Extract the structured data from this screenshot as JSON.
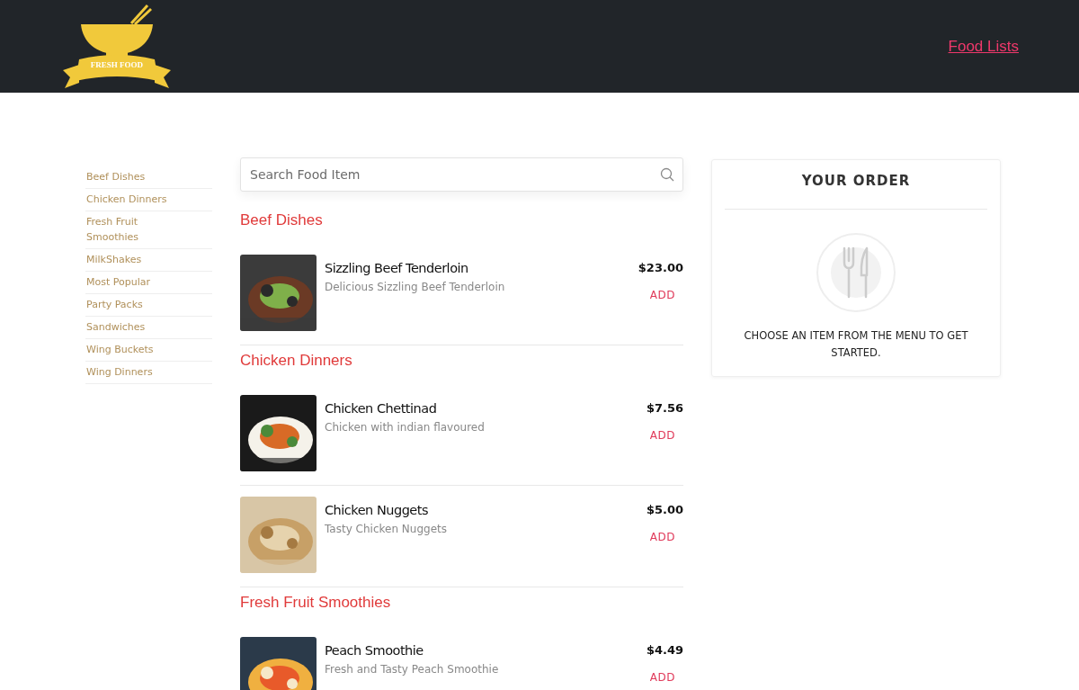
{
  "header": {
    "logo_text": "FRESH FOOD",
    "nav_link": "Food Lists"
  },
  "sidebar": {
    "items": [
      "Beef Dishes",
      "Chicken Dinners",
      "Fresh Fruit Smoothies",
      "MilkShakes",
      "Most Popular",
      "Party Packs",
      "Sandwiches",
      "Wing Buckets",
      "Wing Dinners"
    ]
  },
  "search": {
    "placeholder": "Search Food Item"
  },
  "sections": [
    {
      "title": "Beef Dishes",
      "items": [
        {
          "name": "Sizzling Beef Tenderloin",
          "description": "Delicious Sizzling Beef Tenderloin",
          "price": "$23.00",
          "action": "ADD"
        }
      ]
    },
    {
      "title": "Chicken Dinners",
      "items": [
        {
          "name": "Chicken Chettinad",
          "description": "Chicken with indian flavoured",
          "price": "$7.56",
          "action": "ADD"
        },
        {
          "name": "Chicken Nuggets",
          "description": "Tasty Chicken Nuggets",
          "price": "$5.00",
          "action": "ADD"
        }
      ]
    },
    {
      "title": "Fresh Fruit Smoothies",
      "items": [
        {
          "name": "Peach Smoothie",
          "description": "Fresh and Tasty Peach Smoothie",
          "price": "$4.49",
          "action": "ADD"
        }
      ]
    }
  ],
  "order": {
    "title": "YOUR ORDER",
    "empty_message": "CHOOSE AN ITEM FROM THE MENU TO GET STARTED."
  }
}
